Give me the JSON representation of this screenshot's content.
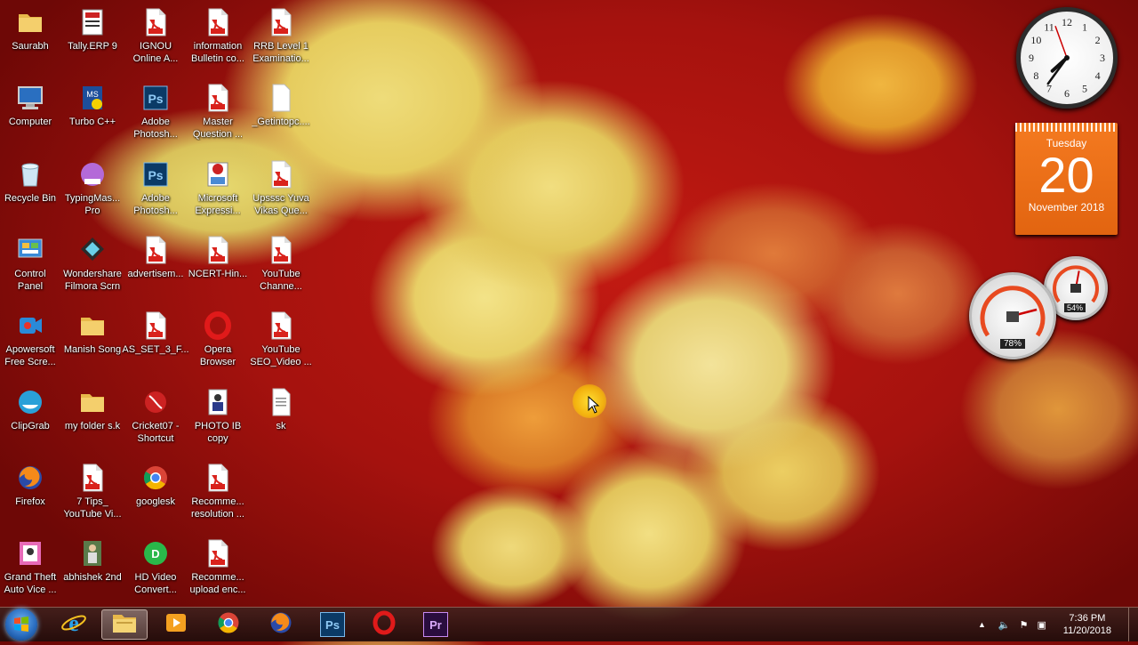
{
  "desktop": {
    "icons": [
      {
        "id": "saurabh",
        "label": "Saurabh",
        "type": "folder",
        "col": 0,
        "row": 0
      },
      {
        "id": "tally",
        "label": "Tally.ERP 9",
        "type": "tally",
        "col": 1,
        "row": 0
      },
      {
        "id": "ignou",
        "label": "IGNOU\nOnline A...",
        "type": "pdf",
        "col": 2,
        "row": 0
      },
      {
        "id": "info-bulletin",
        "label": "information\nBulletin co...",
        "type": "pdf",
        "col": 3,
        "row": 0
      },
      {
        "id": "rrb",
        "label": "RRB Level 1\nExaminatio...",
        "type": "pdf",
        "col": 4,
        "row": 0
      },
      {
        "id": "computer",
        "label": "Computer",
        "type": "computer",
        "col": 0,
        "row": 1
      },
      {
        "id": "turbo",
        "label": "Turbo C++",
        "type": "turbo",
        "col": 1,
        "row": 1
      },
      {
        "id": "photoshop1",
        "label": "Adobe\nPhotosh...",
        "type": "ps",
        "col": 2,
        "row": 1
      },
      {
        "id": "master-question",
        "label": "Master\nQuestion ...",
        "type": "pdf",
        "col": 3,
        "row": 1
      },
      {
        "id": "getintopc",
        "label": "_Getintopc....",
        "type": "blank",
        "col": 4,
        "row": 1
      },
      {
        "id": "recycle",
        "label": "Recycle Bin",
        "type": "recycle",
        "col": 0,
        "row": 2
      },
      {
        "id": "typingmaster",
        "label": "TypingMas...\nPro",
        "type": "typing",
        "col": 1,
        "row": 2
      },
      {
        "id": "photoshop2",
        "label": "Adobe\nPhotosh...",
        "type": "ps",
        "col": 2,
        "row": 2
      },
      {
        "id": "expression",
        "label": "Microsoft\nExpressi...",
        "type": "expression",
        "col": 3,
        "row": 2
      },
      {
        "id": "upsssc",
        "label": "Upsssc Yuva\nVikas Que...",
        "type": "pdf",
        "col": 4,
        "row": 2
      },
      {
        "id": "control-panel",
        "label": "Control\nPanel",
        "type": "control",
        "col": 0,
        "row": 3
      },
      {
        "id": "filmora",
        "label": "Wondershare\nFilmora Scrn",
        "type": "filmora",
        "col": 1,
        "row": 3
      },
      {
        "id": "advertisement",
        "label": "advertisem...",
        "type": "pdf",
        "col": 2,
        "row": 3
      },
      {
        "id": "ncert",
        "label": "NCERT-Hin...",
        "type": "pdf",
        "col": 3,
        "row": 3
      },
      {
        "id": "youtube-channel",
        "label": "YouTube\nChanne...",
        "type": "pdf",
        "col": 4,
        "row": 3
      },
      {
        "id": "apowersoft",
        "label": "Apowersoft\nFree Scre...",
        "type": "apower",
        "col": 0,
        "row": 4
      },
      {
        "id": "manish-song",
        "label": "Manish Song",
        "type": "folder",
        "col": 1,
        "row": 4
      },
      {
        "id": "as-set",
        "label": "AS_SET_3_F...",
        "type": "pdf",
        "col": 2,
        "row": 4
      },
      {
        "id": "opera",
        "label": "Opera\nBrowser",
        "type": "opera",
        "col": 3,
        "row": 4
      },
      {
        "id": "youtube-seo",
        "label": "YouTube\nSEO_Video ...",
        "type": "pdf",
        "col": 4,
        "row": 4
      },
      {
        "id": "clipgrab",
        "label": "ClipGrab",
        "type": "clipgrab",
        "col": 0,
        "row": 5
      },
      {
        "id": "my-folder",
        "label": "my folder s.k",
        "type": "folder",
        "col": 1,
        "row": 5
      },
      {
        "id": "cricket",
        "label": "Cricket07 -\nShortcut",
        "type": "cricket",
        "col": 2,
        "row": 5
      },
      {
        "id": "photo-ib",
        "label": "PHOTO IB\ncopy",
        "type": "photo",
        "col": 3,
        "row": 5
      },
      {
        "id": "sk",
        "label": "sk",
        "type": "txt",
        "col": 4,
        "row": 5
      },
      {
        "id": "firefox",
        "label": "Firefox",
        "type": "firefox",
        "col": 0,
        "row": 6
      },
      {
        "id": "tips",
        "label": "7 Tips_\nYouTube Vi...",
        "type": "pdf",
        "col": 1,
        "row": 6
      },
      {
        "id": "googlesk",
        "label": "googlesk",
        "type": "chrome",
        "col": 2,
        "row": 6
      },
      {
        "id": "recomme1",
        "label": "Recomme...\nresolution ...",
        "type": "pdf",
        "col": 3,
        "row": 6
      },
      {
        "id": "gta",
        "label": "Grand Theft\nAuto Vice ...",
        "type": "gta",
        "col": 0,
        "row": 7
      },
      {
        "id": "abhishek",
        "label": "abhishek 2nd",
        "type": "abhishek",
        "col": 1,
        "row": 7
      },
      {
        "id": "hdvideo",
        "label": "HD Video\nConvert...",
        "type": "hdvideo",
        "col": 2,
        "row": 7
      },
      {
        "id": "recomme2",
        "label": "Recomme...\nupload enc...",
        "type": "pdf",
        "col": 3,
        "row": 7
      }
    ]
  },
  "gadgets": {
    "clock": {
      "hour": 7,
      "minute": 36
    },
    "calendar": {
      "weekday": "Tuesday",
      "day": "20",
      "month_year": "November 2018"
    },
    "meters": {
      "cpu_percent": "78%",
      "memory_percent": "54%",
      "cpu_value": 0.78,
      "memory_value": 0.54
    }
  },
  "clock_numerals": [
    "12",
    "1",
    "2",
    "3",
    "4",
    "5",
    "6",
    "7",
    "8",
    "9",
    "10",
    "11"
  ],
  "taskbar": {
    "pinned": [
      {
        "id": "ie",
        "icon": "ie-icon"
      },
      {
        "id": "explorer",
        "icon": "folder-icon",
        "active": true
      },
      {
        "id": "media",
        "icon": "media-player-icon"
      },
      {
        "id": "chrome",
        "icon": "chrome-icon"
      },
      {
        "id": "firefox",
        "icon": "firefox-icon"
      },
      {
        "id": "photoshop",
        "icon": "photoshop-icon",
        "text": "Ps"
      },
      {
        "id": "opera",
        "icon": "opera-icon"
      },
      {
        "id": "premiere",
        "icon": "premiere-icon",
        "text": "Pr"
      }
    ],
    "time": "7:36 PM",
    "date": "11/20/2018"
  },
  "colors": {
    "pdf_red": "#d9221c",
    "ps_blue": "#0b3a66",
    "pr_purple": "#2a0d3e",
    "calendar_orange": "#f07020"
  }
}
